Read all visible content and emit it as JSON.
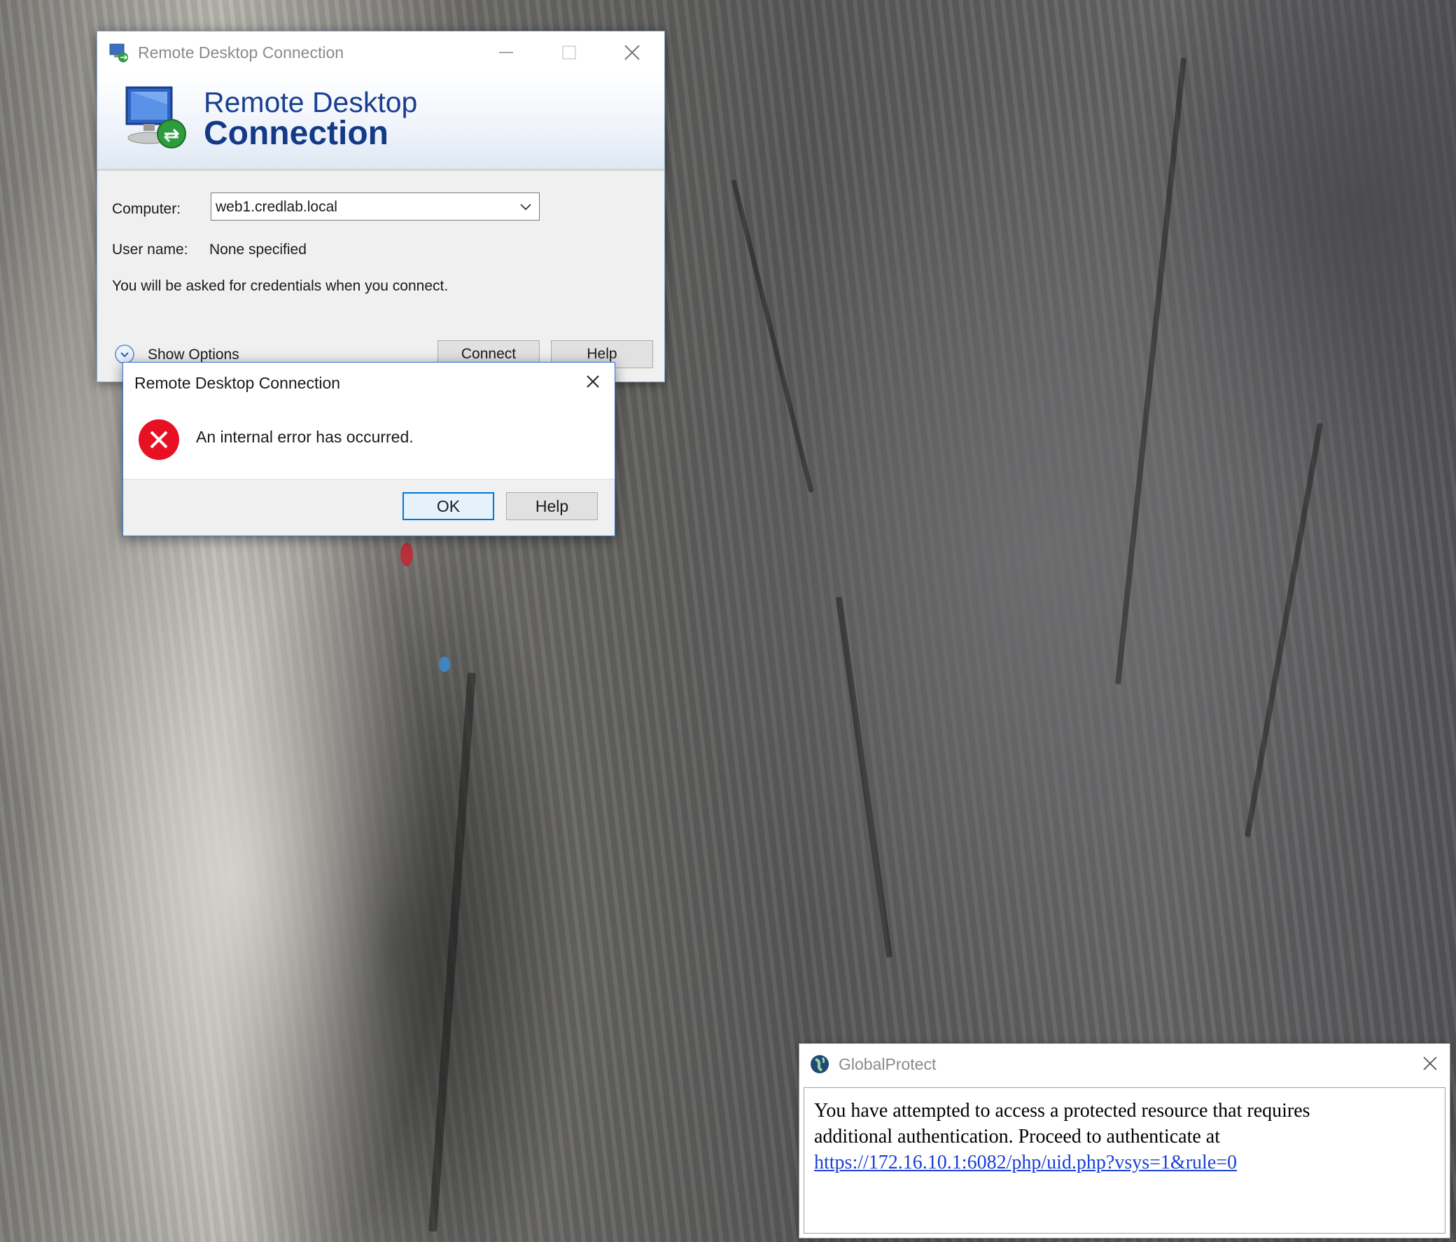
{
  "rdc_window": {
    "title": "Remote Desktop Connection",
    "banner_line1": "Remote Desktop",
    "banner_line2": "Connection",
    "computer_label": "Computer:",
    "computer_value": "web1.credlab.local",
    "username_label": "User name:",
    "username_value": "None specified",
    "credentials_note": "You will be asked for credentials when you connect.",
    "show_options_label": "Show Options",
    "connect_label": "Connect",
    "help_label": "Help"
  },
  "error_dialog": {
    "title": "Remote Desktop Connection",
    "message": "An internal error has occurred.",
    "ok_label": "OK",
    "help_label": "Help"
  },
  "globalprotect": {
    "title": "GlobalProtect",
    "message_line1": "You have attempted to access a protected resource that requires",
    "message_line2": "additional authentication. Proceed to authenticate at",
    "link": "https://172.16.10.1:6082/php/uid.php?vsys=1&rule=0"
  },
  "icons": [
    "rdc-app-icon",
    "minimize-icon",
    "maximize-icon",
    "close-icon",
    "chevron-down-icon",
    "expand-circle-icon",
    "error-icon",
    "globalprotect-globe-icon"
  ],
  "colors": {
    "accent": "#0078d7",
    "banner_text": "#1a3f8f",
    "error_red": "#e81123",
    "link": "#1a3fd6"
  }
}
